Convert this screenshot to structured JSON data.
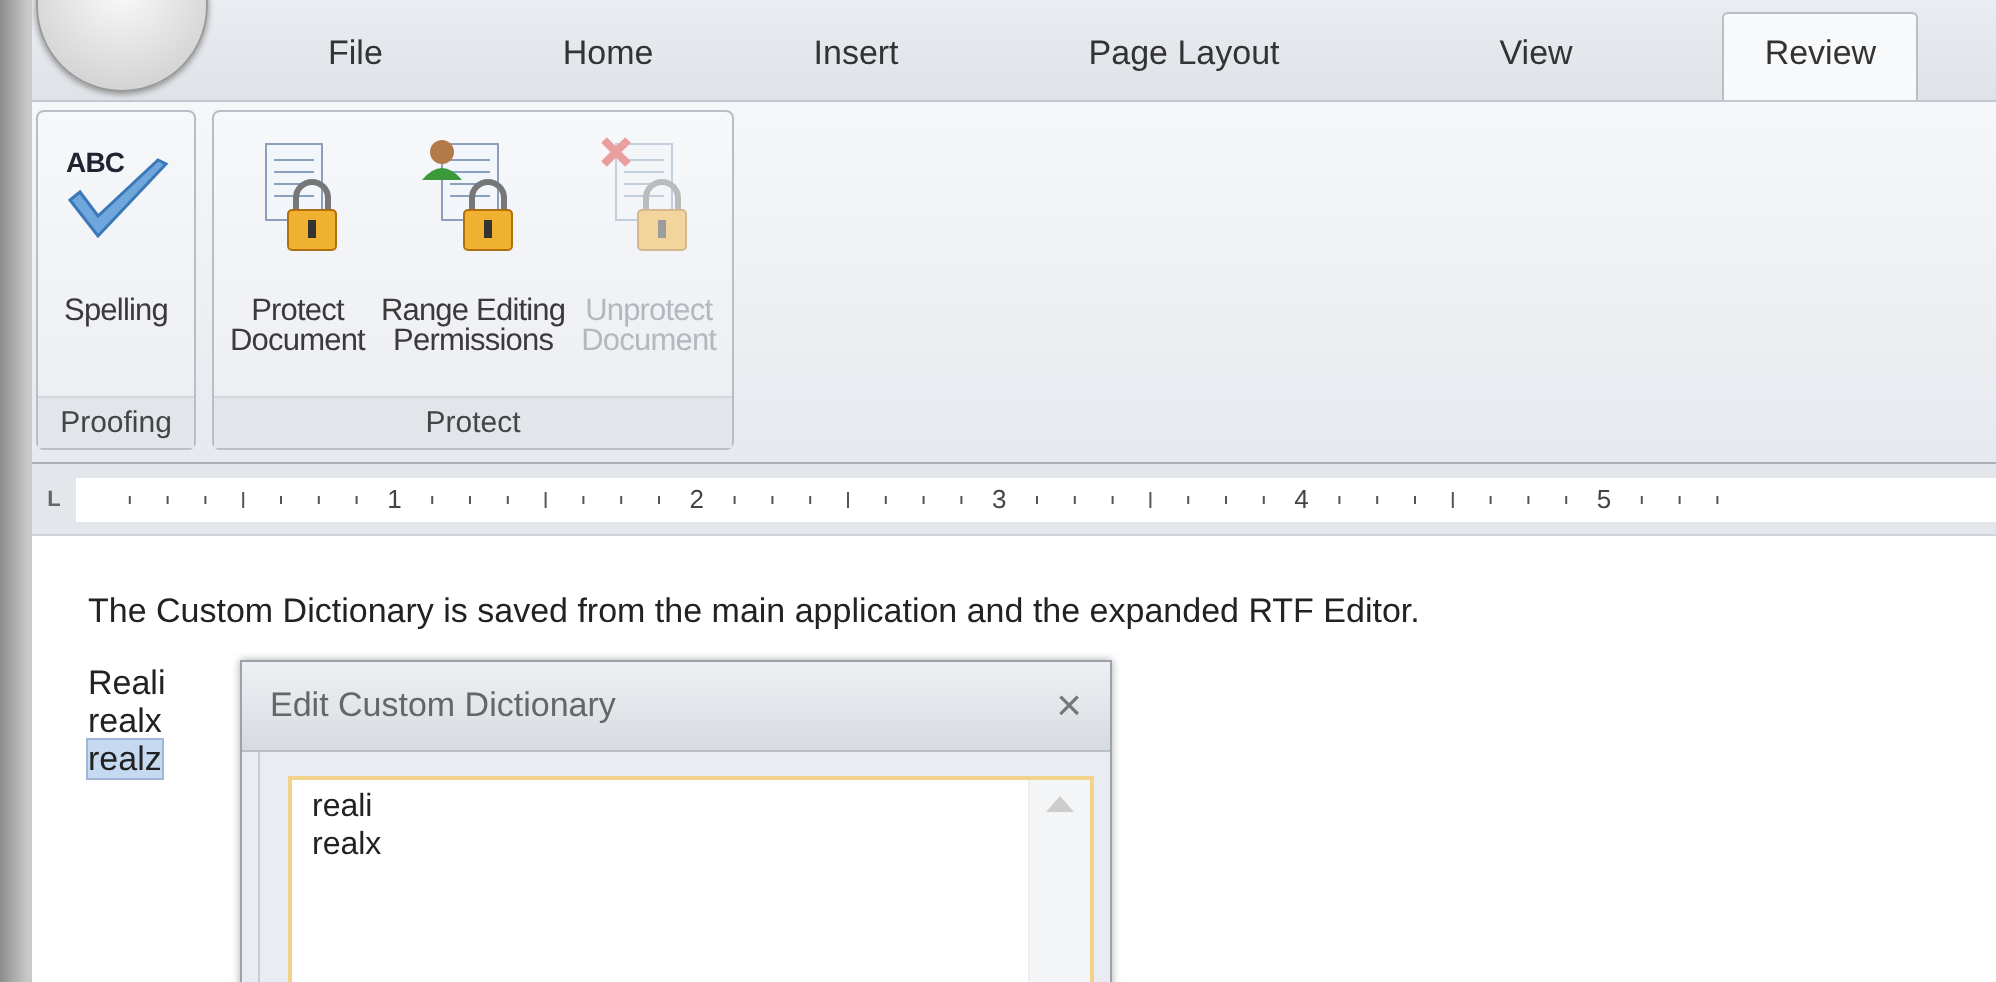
{
  "ribbon_tabs": [
    {
      "label": "File",
      "selected": false
    },
    {
      "label": "Home",
      "selected": false
    },
    {
      "label": "Insert",
      "selected": false
    },
    {
      "label": "Page Layout",
      "selected": false
    },
    {
      "label": "View",
      "selected": false
    },
    {
      "label": "Review",
      "selected": true
    }
  ],
  "ribbon_groups": [
    {
      "label": "Proofing",
      "buttons": [
        {
          "kind": "spelling",
          "label": "Spelling",
          "icon_text": "ABC",
          "disabled": false
        }
      ]
    },
    {
      "label": "Protect",
      "buttons": [
        {
          "kind": "protect",
          "label": "Protect Document",
          "disabled": false
        },
        {
          "kind": "permissions",
          "label": "Range Editing Permissions",
          "disabled": false
        },
        {
          "kind": "unprotect",
          "label": "Unprotect Document",
          "disabled": true
        }
      ]
    }
  ],
  "ruler": {
    "tab_stop": "L",
    "numbers": [
      "1",
      "2",
      "3",
      "4",
      "5"
    ]
  },
  "document": {
    "paragraph": "The Custom Dictionary is saved from the main application and the expanded RTF Editor.",
    "words": [
      {
        "text": "Reali",
        "selected": false
      },
      {
        "text": "realx",
        "selected": false
      },
      {
        "text": "realz",
        "selected": true
      }
    ]
  },
  "dialog": {
    "title": "Edit Custom Dictionary",
    "close": "×",
    "entries": [
      "reali",
      "realx"
    ]
  }
}
